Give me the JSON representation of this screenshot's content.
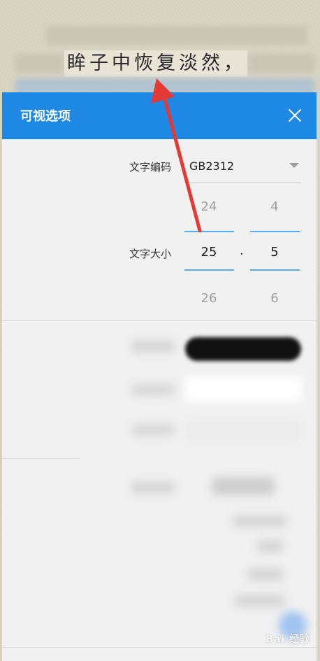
{
  "reader": {
    "highlighted_sentence": "眸子中恢复淡然，"
  },
  "dialog": {
    "title": "可视选项",
    "close_label": "✕",
    "encoding": {
      "label": "文字编码",
      "value": "GB2312"
    },
    "font_size": {
      "label": "文字大小",
      "integer_picker": {
        "above": "24",
        "selected": "25",
        "below": "26"
      },
      "separator": ".",
      "decimal_picker": {
        "above": "4",
        "selected": "5",
        "below": "6"
      }
    }
  },
  "watermark": "Bai 经验",
  "colors": {
    "header_blue": "#1e88e5",
    "picker_underline": "#5aaee8",
    "annotation_arrow": "#e53935"
  }
}
